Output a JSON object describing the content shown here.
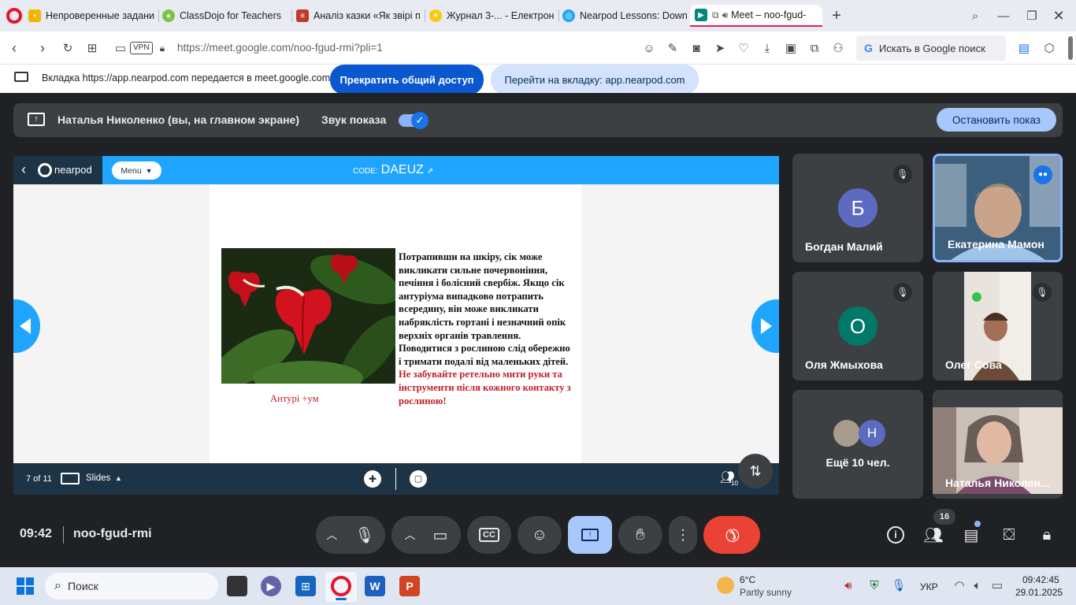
{
  "tabs": [
    {
      "label": "Непроверенные задания",
      "icon": "classroom-icon"
    },
    {
      "label": "ClassDojo for Teachers",
      "icon": "classdojo-icon"
    },
    {
      "label": "Аналіз казки «Як звірі пр",
      "icon": "book-icon"
    },
    {
      "label": "Журнал 3-... - Електронні",
      "icon": "sun-icon"
    },
    {
      "label": "Nearpod Lessons: Downlo",
      "icon": "nearpod-icon"
    },
    {
      "label": "Meet – noo-fgud-",
      "icon": "meet-icon"
    }
  ],
  "browser": {
    "url": "https://meet.google.com/noo-fgud-rmi?pli=1",
    "vpn": "VPN",
    "search_label": "Искать в Google поиск"
  },
  "share_bar": {
    "message": "Вкладка https://app.nearpod.com передается в meet.google.com",
    "stop_sharing": "Прекратить общий доступ",
    "go_to_tab": "Перейти на вкладку: app.nearpod.com"
  },
  "presenting": {
    "presenter": "Наталья Николенко (вы, на главном экране)",
    "audio_label": "Звук показа",
    "audio_on": true,
    "stop_button": "Остановить показ"
  },
  "nearpod": {
    "logo": "nearpod",
    "menu": "Menu",
    "code_label": "CODE:",
    "code": "DAEUZ",
    "slide_paragraph": "Потрапивши на шкіру, сік може викликати сильне почервоніння, печіння і болісний свербіж. Якщо сік антуріума випадково потрапить всередину, він може викликати набряклість гортані і незначний опік верхніх органів травлення. Поводитися з рослиною слід обережно і тримати подалі від маленьких дітей.",
    "slide_warning": "Не забувайте ретельно мити руки та інструменти після кожного контакту з рослиною!",
    "image_caption": "Антурі +ум",
    "page_indicator": "7 of 11",
    "slides_label": "Slides",
    "participants_count": "10"
  },
  "participants": [
    {
      "name": "Богдан Малий",
      "initial": "Б",
      "color": "#5c6bc0",
      "muted": true
    },
    {
      "name": "Екатерина Мамон",
      "speaking": true
    },
    {
      "name": "Оля Жмыхова",
      "initial": "О",
      "color": "#00796b",
      "muted": true
    },
    {
      "name": "Олег Сова",
      "muted": true
    },
    {
      "name": "Ещё 10 чел.",
      "initial": "Н",
      "color": "#5c6bc0"
    },
    {
      "name": "Наталья Николен..."
    }
  ],
  "meeting": {
    "time": "09:42",
    "code": "noo-fgud-rmi",
    "people_badge": "16"
  },
  "taskbar": {
    "search": "Поиск",
    "weather_temp": "6°C",
    "weather_desc": "Partly sunny",
    "lang": "УКР",
    "clock_time": "09:42:45",
    "clock_date": "29.01.2025"
  }
}
